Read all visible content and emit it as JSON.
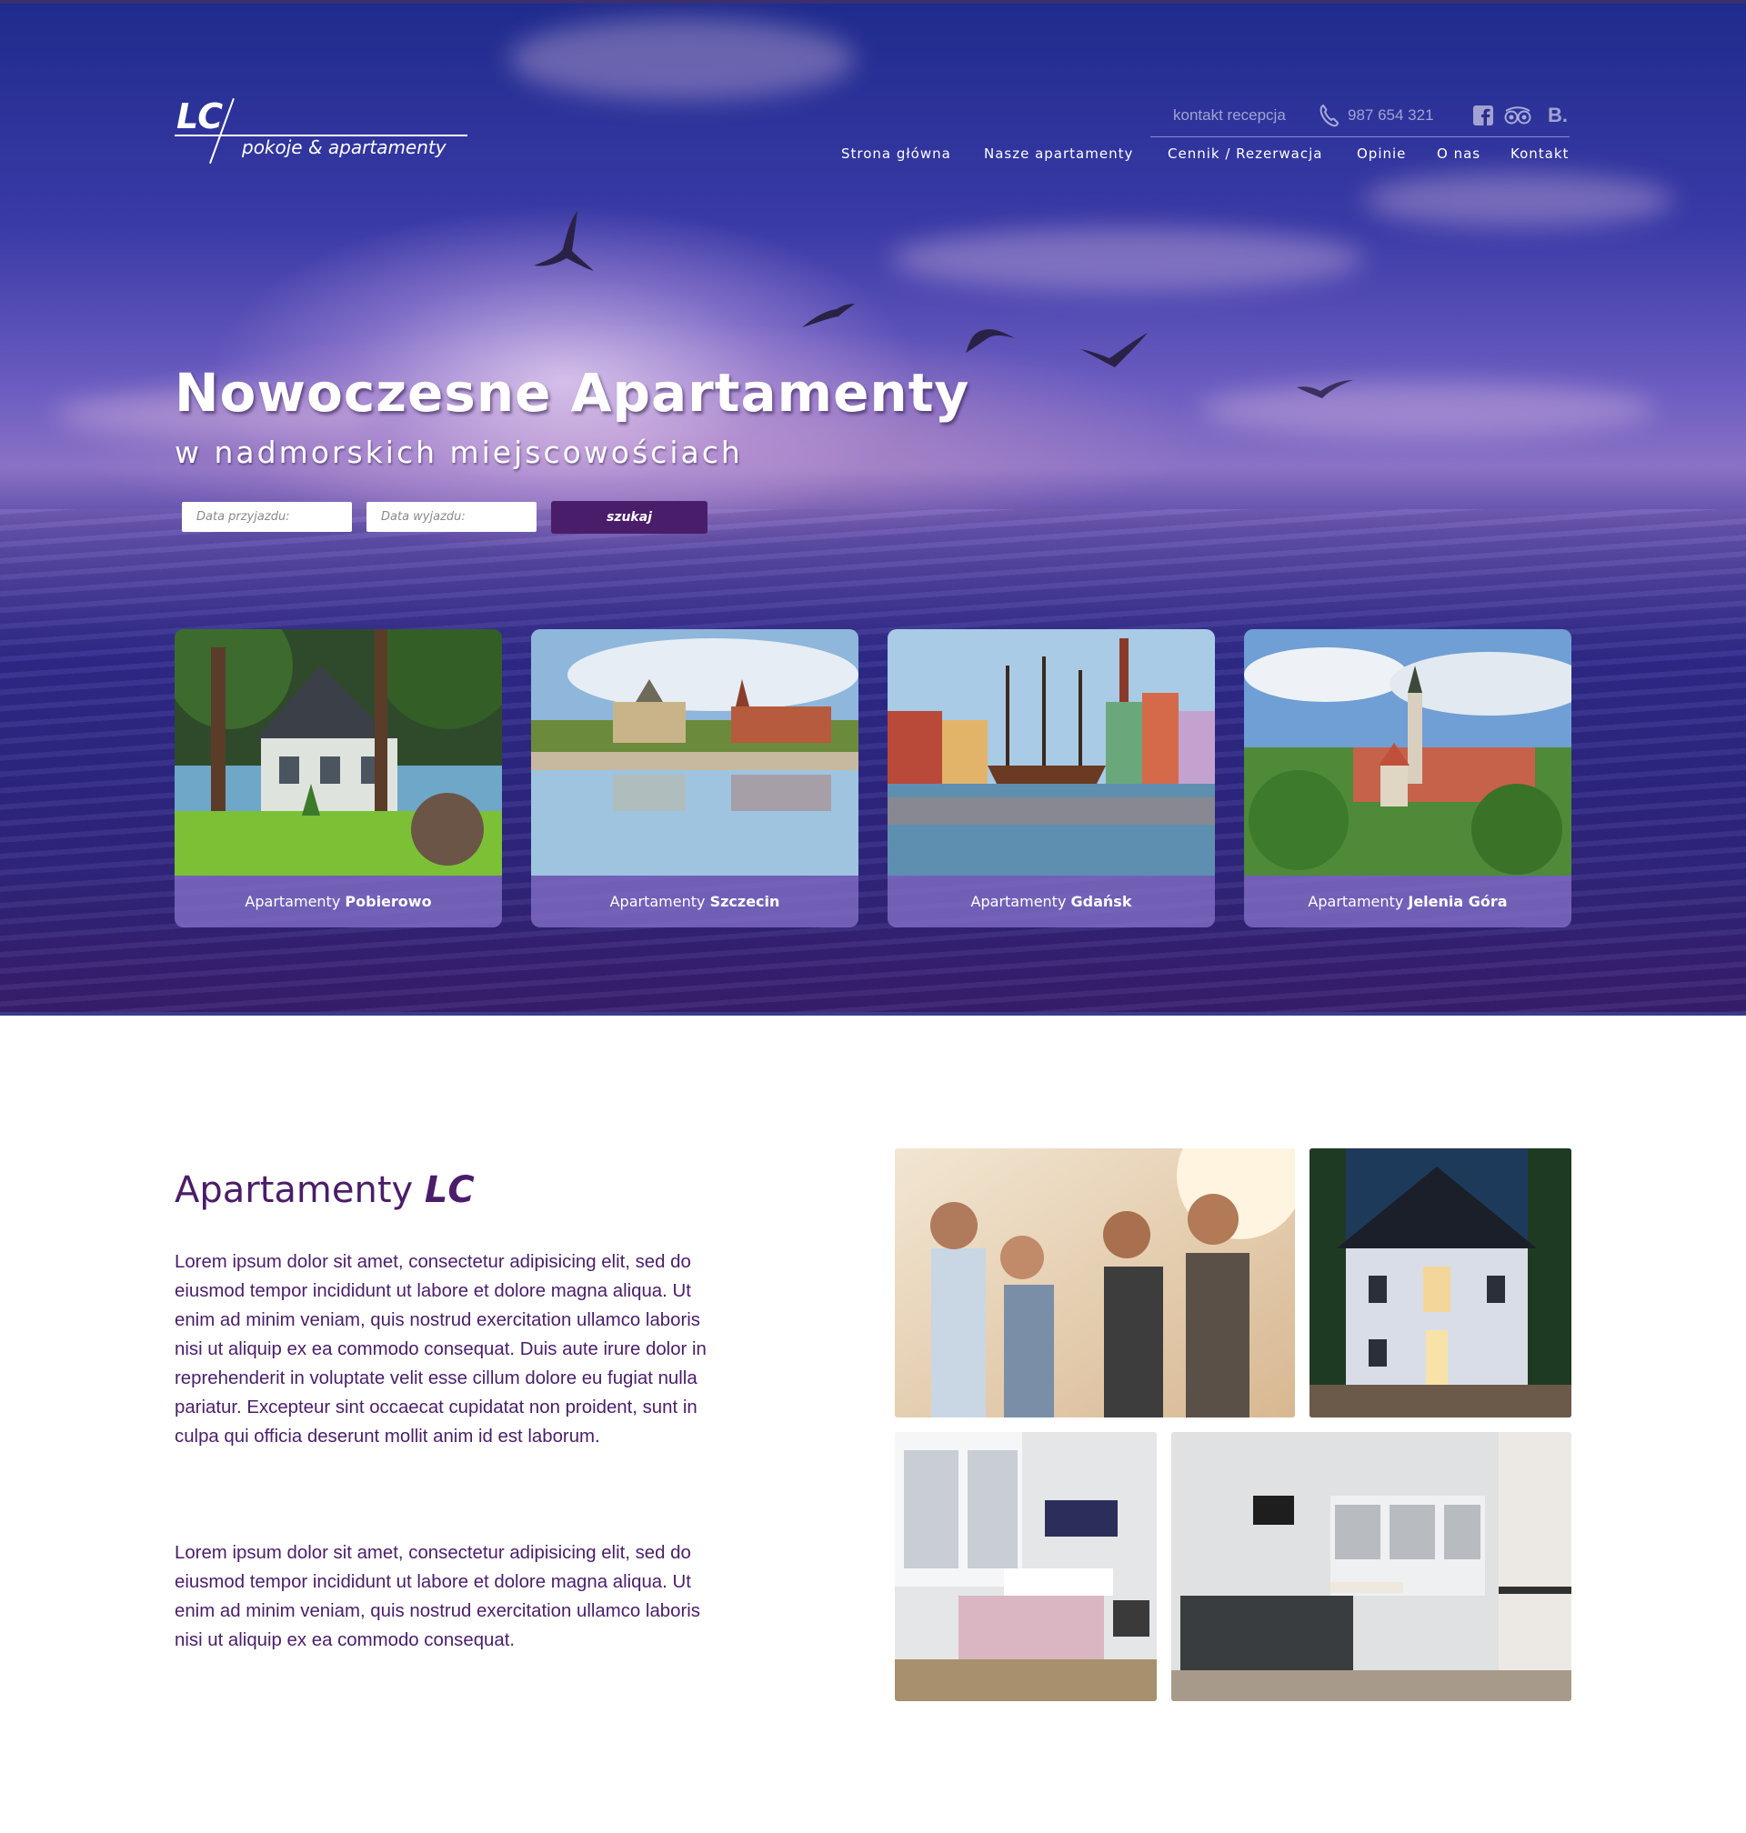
{
  "brand": {
    "logo_mark": "LC",
    "logo_tagline": "pokoje & apartamenty"
  },
  "topbar": {
    "contact_label": "kontakt recepcja",
    "phone": "987 654 321",
    "social_icons": [
      "facebook-icon",
      "tripadvisor-icon",
      "booking-icon"
    ],
    "booking_mark": "B."
  },
  "nav": {
    "items": [
      {
        "label": "Strona główna"
      },
      {
        "label": "Nasze apartamenty"
      },
      {
        "label": "Cennik / Rezerwacja"
      },
      {
        "label": "Opinie"
      },
      {
        "label": "O nas"
      },
      {
        "label": "Kontakt"
      }
    ]
  },
  "hero": {
    "title": "Nowoczesne Apartamenty",
    "subtitle": "w nadmorskich miejscowościach"
  },
  "search": {
    "arrival_placeholder": "Data przyjazdu:",
    "departure_placeholder": "Data wyjazdu:",
    "button_label": "szukaj"
  },
  "locations": [
    {
      "prefix": "Apartamenty",
      "name": "Pobierowo"
    },
    {
      "prefix": "Apartamenty",
      "name": "Szczecin"
    },
    {
      "prefix": "Apartamenty",
      "name": "Gdańsk"
    },
    {
      "prefix": "Apartamenty",
      "name": "Jelenia Góra"
    }
  ],
  "about": {
    "title_prefix": "Apartamenty",
    "title_brand": "LC",
    "paragraph_1": "Lorem ipsum dolor sit amet, consectetur adipisicing elit, sed do eiusmod tempor incididunt ut labore et dolore magna aliqua. Ut enim ad minim veniam, quis nostrud exercitation ullamco laboris nisi ut aliquip ex ea commodo consequat. Duis aute irure dolor in reprehenderit in voluptate velit esse cillum dolore eu fugiat nulla pariatur. Excepteur sint occaecat cupidatat non proident, sunt in culpa qui officia deserunt mollit anim id est laborum.",
    "paragraph_2": "Lorem ipsum dolor sit amet, consectetur adipisicing elit, sed do eiusmod tempor incididunt ut labore et dolore magna aliqua. Ut enim ad minim veniam, quis nostrud exercitation ullamco laboris nisi ut aliquip ex ea commodo consequat."
  },
  "colors": {
    "accent": "#4a1d6a",
    "hero_top": "#1e2b8c",
    "hero_bottom": "#2a1f6e",
    "text_on_hero": "#ffffff"
  }
}
